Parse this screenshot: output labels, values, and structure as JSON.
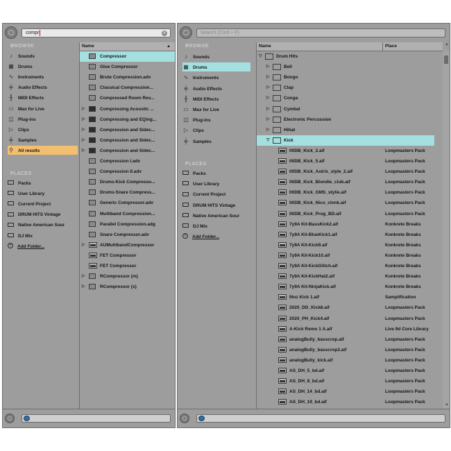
{
  "left": {
    "search": {
      "value": "compr"
    },
    "browse_title": "BROWSE",
    "places_title": "PLACES",
    "browse": [
      {
        "label": "Sounds",
        "icon": "note-icon"
      },
      {
        "label": "Drums",
        "icon": "drum-grid-icon"
      },
      {
        "label": "Instruments",
        "icon": "wave-icon"
      },
      {
        "label": "Audio Effects",
        "icon": "audio-fx-icon"
      },
      {
        "label": "MIDI Effects",
        "icon": "midi-fx-icon"
      },
      {
        "label": "Max for Live",
        "icon": "max-icon"
      },
      {
        "label": "Plug-ins",
        "icon": "plugin-icon"
      },
      {
        "label": "Clips",
        "icon": "clip-icon"
      },
      {
        "label": "Samples",
        "icon": "sample-icon"
      },
      {
        "label": "All results",
        "icon": "search-icon"
      }
    ],
    "places": [
      {
        "label": "Packs"
      },
      {
        "label": "User Library"
      },
      {
        "label": "Current Project"
      },
      {
        "label": "DRUM HITS Vintage"
      },
      {
        "label": "Native American Sour"
      },
      {
        "label": "DJ Mix"
      },
      {
        "label": "Add Folder..."
      }
    ],
    "col_name": "Name",
    "results": [
      "Compressor",
      "Glue Compressor",
      "Brute Compression.adv",
      "Classical Compression...",
      "Compressed Room Rev...",
      "Compressing Acoustic ...",
      "Compressing and EQing...",
      "Compression and Sidec...",
      "Compression and Sidec...",
      "Compression and Sidec...",
      "Compression I.adv",
      "Compression II.adv",
      "Drums-Kick Compresso...",
      "Drums-Snare Compress...",
      "Generic Compressor.adv",
      "Multiband Compression...",
      "Parallel Compression.adg",
      "Snare Compressor.adv",
      "AUMultibandCompressor",
      "FET Compressor",
      "FET Compressor",
      "RCompressor (m)",
      "RCompressor (s)"
    ]
  },
  "right": {
    "search": {
      "placeholder": "Search (Cmd + F)"
    },
    "browse_title": "BROWSE",
    "places_title": "PLACES",
    "browse": [
      {
        "label": "Sounds"
      },
      {
        "label": "Drums"
      },
      {
        "label": "Instruments"
      },
      {
        "label": "Audio Effects"
      },
      {
        "label": "MIDI Effects"
      },
      {
        "label": "Max for Live"
      },
      {
        "label": "Plug-ins"
      },
      {
        "label": "Clips"
      },
      {
        "label": "Samples"
      }
    ],
    "places": [
      {
        "label": "Packs"
      },
      {
        "label": "User Library"
      },
      {
        "label": "Current Project"
      },
      {
        "label": "DRUM HITS Vintage"
      },
      {
        "label": "Native American Sour"
      },
      {
        "label": "DJ Mix"
      },
      {
        "label": "Add Folder..."
      }
    ],
    "col_name": "Name",
    "col_place": "Place",
    "tree_root": "Drum Hits",
    "folders": [
      "Bell",
      "Bongo",
      "Clap",
      "Conga",
      "Cymbal",
      "Electronic Percussion",
      "Hihat",
      "Kick"
    ],
    "files": [
      {
        "name": "00DB_Kick_2.aif",
        "place": "Loopmasters Pack"
      },
      {
        "name": "00DB_Kick_5.aif",
        "place": "Loopmasters Pack"
      },
      {
        "name": "00DB_Kick_Astrix_style_2.aif",
        "place": "Loopmasters Pack"
      },
      {
        "name": "00DB_Kick_Blondie_club.aif",
        "place": "Loopmasters Pack"
      },
      {
        "name": "00DB_Kick_GMS_stylie.aif",
        "place": "Loopmasters Pack"
      },
      {
        "name": "00DB_Kick_Nico_clonk.aif",
        "place": "Loopmasters Pack"
      },
      {
        "name": "00DB_Kick_Prog_BD.aif",
        "place": "Loopmasters Pack"
      },
      {
        "name": "7y9A Kit-BassKick2.aif",
        "place": "Konkrete Breaks"
      },
      {
        "name": "7y9A Kit-BlueKick1.aif",
        "place": "Konkrete Breaks"
      },
      {
        "name": "7y9A Kit-Kick9.aif",
        "place": "Konkrete Breaks"
      },
      {
        "name": "7y9A Kit-Kick10.aif",
        "place": "Konkrete Breaks"
      },
      {
        "name": "7y9A Kit-KickGlitch.aif",
        "place": "Konkrete Breaks"
      },
      {
        "name": "7y9A Kit-KickHat2.aif",
        "place": "Konkrete Breaks"
      },
      {
        "name": "7y9A Kit-NinjaKick.aif",
        "place": "Konkrete Breaks"
      },
      {
        "name": "9inz Kick 1.aif",
        "place": "Samplification"
      },
      {
        "name": "2020_DD_Kick8.aif",
        "place": "Loopmasters Pack"
      },
      {
        "name": "2020_PH_Kick4.aif",
        "place": "Loopmasters Pack"
      },
      {
        "name": "A-Kick Remo 1 A.aif",
        "place": "Live 9d Core Library"
      },
      {
        "name": "analogBully_basscrop.aif",
        "place": "Loopmasters Pack"
      },
      {
        "name": "analogBully_basscrop2.aif",
        "place": "Loopmasters Pack"
      },
      {
        "name": "analogBully_kick.aif",
        "place": "Loopmasters Pack"
      },
      {
        "name": "AS_DH_5_bd.aif",
        "place": "Loopmasters Pack"
      },
      {
        "name": "AS_DH_8_bd.aif",
        "place": "Loopmasters Pack"
      },
      {
        "name": "AS_DH_14_bd.aif",
        "place": "Loopmasters Pack"
      },
      {
        "name": "AS_DH_19_bd.aif",
        "place": "Loopmasters Pack"
      }
    ]
  },
  "colors": {
    "panel": "#9d9d9d",
    "selection": "#a4e0e0",
    "all_results": "#f2bf6f"
  }
}
